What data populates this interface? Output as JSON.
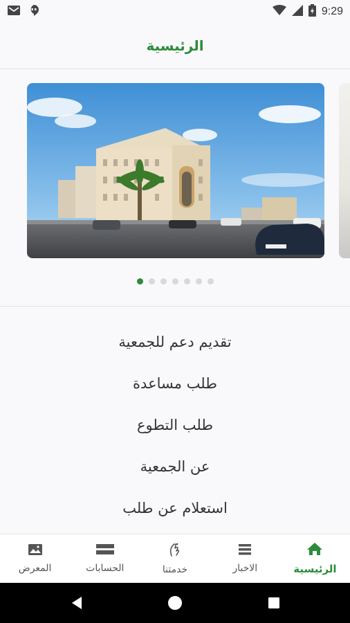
{
  "status_bar": {
    "time": "9:29",
    "icons": [
      "gmail-icon",
      "hangouts-icon",
      "wifi-icon",
      "signal-icon",
      "battery-icon"
    ]
  },
  "header": {
    "title": "الرئيسية"
  },
  "carousel": {
    "slide_count": 7,
    "active_index": 0,
    "slides": [
      "building-photo",
      "next-photo-partial"
    ]
  },
  "menu": {
    "items": [
      {
        "label": "تقديم دعم للجمعية"
      },
      {
        "label": "طلب مساعدة"
      },
      {
        "label": "طلب التطوع"
      },
      {
        "label": "عن الجمعية"
      },
      {
        "label": "استعلام عن طلب"
      }
    ]
  },
  "bottom_nav": {
    "items": [
      {
        "label": "المعرض",
        "icon": "gallery-icon",
        "active": false
      },
      {
        "label": "الحسابات",
        "icon": "accounts-icon",
        "active": false
      },
      {
        "label": "خدمتنا",
        "icon": "hand-icon",
        "active": false
      },
      {
        "label": "الاخبار",
        "icon": "news-icon",
        "active": false
      },
      {
        "label": "الرئيسية",
        "icon": "home-icon",
        "active": true
      }
    ]
  },
  "colors": {
    "accent": "#2c8c3c",
    "text": "#333333",
    "background": "#f9f9fb"
  }
}
